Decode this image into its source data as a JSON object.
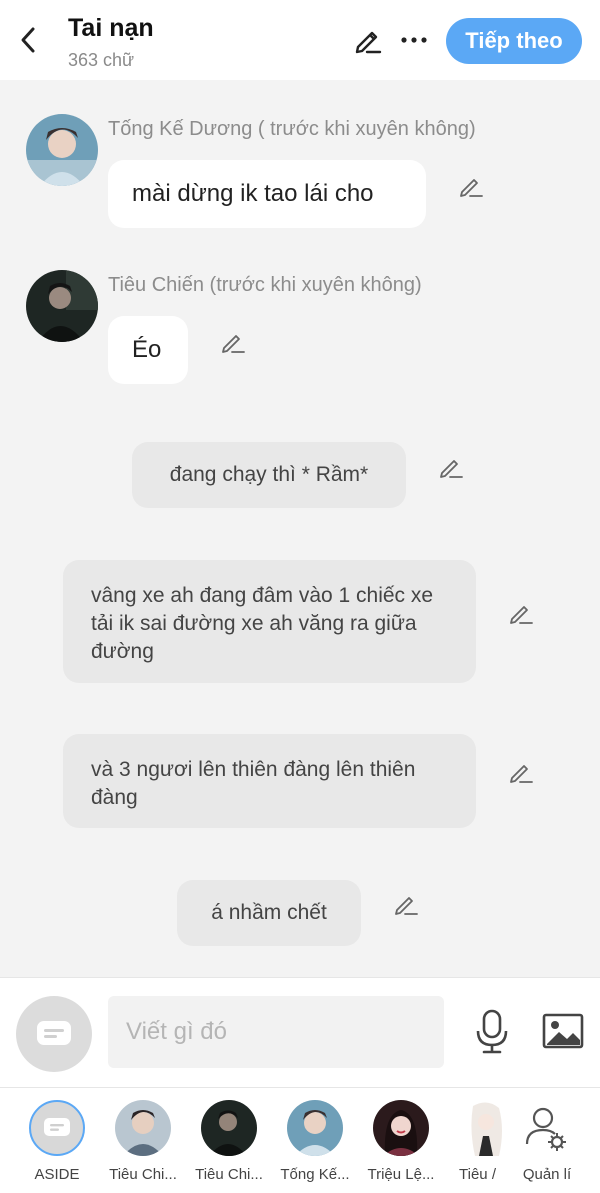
{
  "header": {
    "back_icon": "chevron-left-icon",
    "title": "Tai nạn",
    "word_count": "363 chữ",
    "edit_icon": "pencil-icon",
    "more_icon": "more-horizontal-icon",
    "next_label": "Tiếp theo",
    "accent": "#5ba8f5"
  },
  "messages": [
    {
      "type": "character",
      "sender": "Tống Kế Dương ( trước khi xuyên không)",
      "text": "mài dừng ik tao lái cho"
    },
    {
      "type": "character",
      "sender": "Tiêu Chiến (trước khi xuyên không)",
      "text": "Éo"
    },
    {
      "type": "aside",
      "text": "đang chạy thì * Rầm*"
    },
    {
      "type": "aside",
      "text": "vâng xe ah đang đâm vào 1 chiếc xe tải ik sai đường xe ah văng ra giữa đường"
    },
    {
      "type": "aside",
      "text": "và 3 ngươi lên thiên đàng lên thiên đàng"
    },
    {
      "type": "aside",
      "text": "á nhầm chết"
    }
  ],
  "composer": {
    "placeholder": "Viết gì đó",
    "mic_icon": "microphone-icon",
    "image_icon": "image-icon",
    "aside_icon": "message-bubble-icon"
  },
  "characters": [
    {
      "label": "ASIDE",
      "selected": true
    },
    {
      "label": "Tiêu Chi..."
    },
    {
      "label": "Tiêu Chi..."
    },
    {
      "label": "Tống Kế..."
    },
    {
      "label": "Triệu Lệ..."
    },
    {
      "label": "Tiêu /"
    },
    {
      "label": "Quản lí"
    }
  ]
}
